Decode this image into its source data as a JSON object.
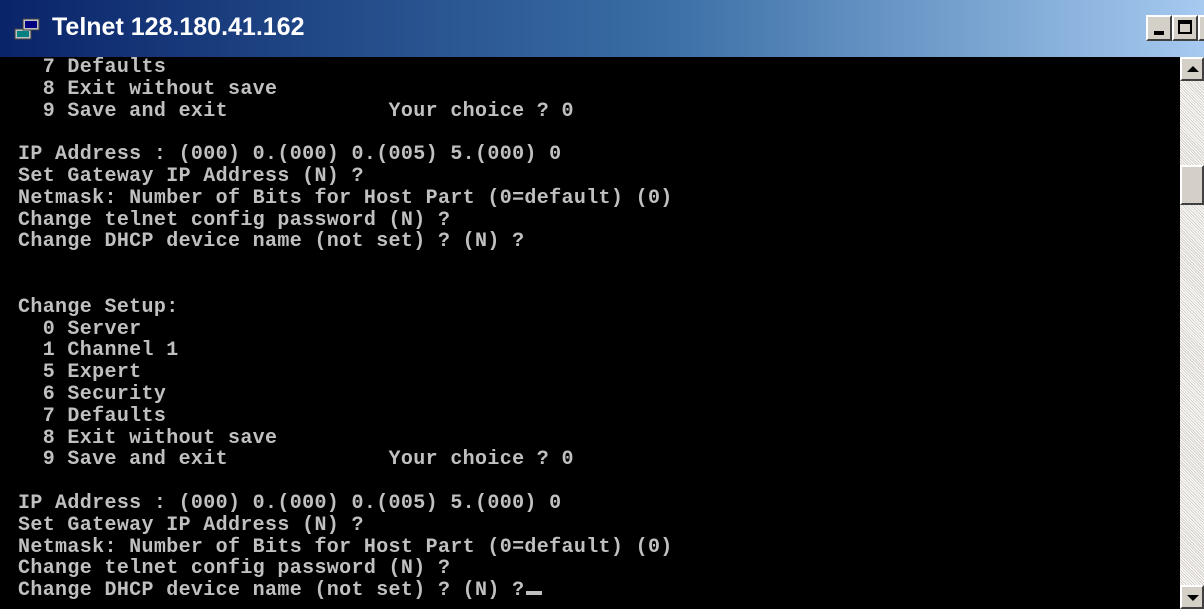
{
  "window": {
    "title": "Telnet 128.180.41.162",
    "icons": {
      "app": "telnet-computer-icon",
      "minimize": "minimize-icon",
      "maximize": "maximize-icon",
      "close": "close-icon",
      "scroll_up": "arrow-up-icon",
      "scroll_down": "arrow-down-icon"
    },
    "colors": {
      "title_bar": "#0a246a",
      "console_background": "#000000",
      "console_text": "#c0c0c0"
    }
  },
  "console": {
    "lines": [
      "  7 Defaults",
      "  8 Exit without save",
      "  9 Save and exit             Your choice ? 0",
      "",
      "IP Address : (000) 0.(000) 0.(005) 5.(000) 0",
      "Set Gateway IP Address (N) ?",
      "Netmask: Number of Bits for Host Part (0=default) (0)",
      "Change telnet config password (N) ?",
      "Change DHCP device name (not set) ? (N) ?",
      "",
      "",
      "Change Setup:",
      "  0 Server",
      "  1 Channel 1",
      "  5 Expert",
      "  6 Security",
      "  7 Defaults",
      "  8 Exit without save",
      "  9 Save and exit             Your choice ? 0",
      "",
      "IP Address : (000) 0.(000) 0.(005) 5.(000) 0",
      "Set Gateway IP Address (N) ?",
      "Netmask: Number of Bits for Host Part (0=default) (0)",
      "Change telnet config password (N) ?"
    ],
    "prompt_line": "Change DHCP device name (not set) ? (N) ?"
  }
}
